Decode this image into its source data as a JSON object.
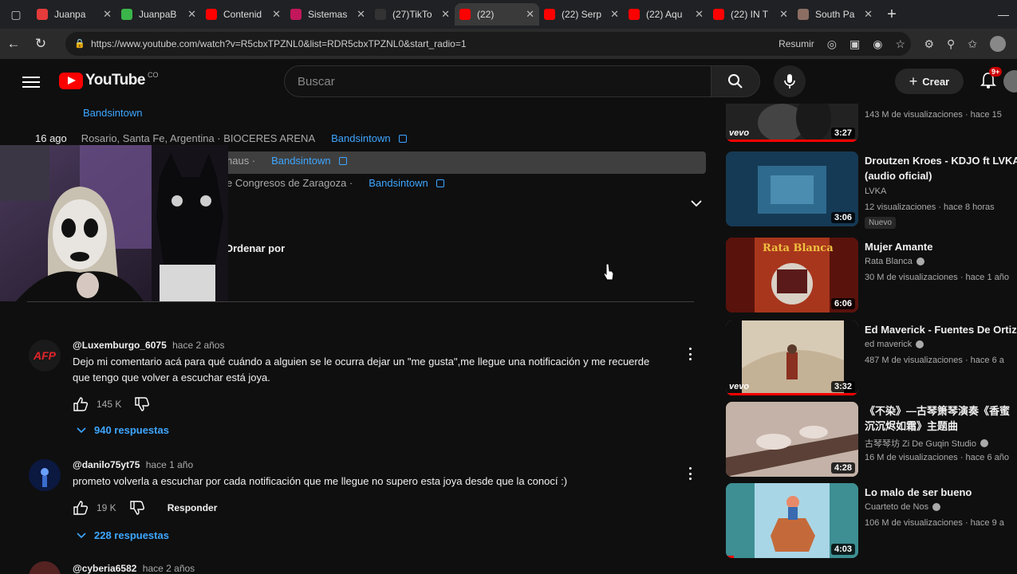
{
  "browser": {
    "tabs": [
      {
        "label": "Juanpa",
        "color": "#e43b3b",
        "icon": "tiktok-icon"
      },
      {
        "label": "JuanpaB",
        "color": "#3bb54a",
        "icon": "kick-icon"
      },
      {
        "label": "Contenid",
        "color": "#ff0000",
        "icon": "youtube-icon"
      },
      {
        "label": "Sistemas",
        "color": "#c2185b",
        "icon": "doc-icon"
      },
      {
        "label": "(27)TikTo",
        "color": "#333333",
        "icon": "tiktok-icon"
      },
      {
        "label": "(22)",
        "color": "#ff0000",
        "icon": "youtube-icon",
        "active": true
      },
      {
        "label": "(22) Serp",
        "color": "#ff0000",
        "icon": "youtube-icon"
      },
      {
        "label": "(22) Aqu",
        "color": "#ff0000",
        "icon": "youtube-icon"
      },
      {
        "label": "(22) IN T",
        "color": "#ff0000",
        "icon": "youtube-icon"
      },
      {
        "label": "South Pa",
        "color": "#8d6e63",
        "icon": "page-icon"
      }
    ],
    "url": "https://www.youtube.com/watch?v=R5cbxTPZNL0&list=RDR5cbxTPZNL0&start_radio=1",
    "summarize_label": "Resumir"
  },
  "yt": {
    "logo_text": "YouTube",
    "logo_region": "CO",
    "search_placeholder": "Buscar",
    "create_label": "Crear",
    "notif_count": "9+"
  },
  "tours": {
    "top_link": "Bandsintown",
    "rows": [
      {
        "date": "16 ago",
        "place": "Rosario, Santa Fe, Argentina · BIOCERES ARENA",
        "link": "Bandsintown"
      },
      {
        "date": "",
        "place": "haus ·",
        "link": "Bandsintown"
      },
      {
        "date": "",
        "place": "e Congresos de Zaragoza ·",
        "link": "Bandsintown"
      }
    ]
  },
  "comments_header": {
    "sort_label": "Ordenar por"
  },
  "comments": [
    {
      "user": "@Luxemburgo_6075",
      "time": "hace 2 años",
      "avatar_text": "AFP",
      "text": "Dejo mi comentario acá para qué cuándo   a alguien se le ocurra dejar un \"me gusta\",me llegue una notificación y me recuerde que tengo que volver a escuchar está joya.",
      "likes": "145 K",
      "replies": "940 respuestas",
      "reply_label": ""
    },
    {
      "user": "@danilo75yt75",
      "time": "hace 1 año",
      "avatar_text": "",
      "text": "prometo volverla a escuchar por cada notificación que me llegue no supero esta joya desde que la conocí :)",
      "likes": "19 K",
      "replies": "228 respuestas",
      "reply_label": "Responder"
    },
    {
      "user": "@cyberia6582",
      "time": "hace 2 años",
      "avatar_text": "",
      "text": "",
      "likes": "",
      "replies": "",
      "reply_label": ""
    }
  ],
  "sidebar": {
    "videos": [
      {
        "title": "",
        "channel": "",
        "meta": "143 M de visualizaciones · hace 15",
        "duration": "3:27",
        "vevo": "vevo",
        "thumb": "#3a3a3a"
      },
      {
        "title": "Droutzen Kroes - KDJO ft LVKA",
        "title2": "(audio oficial)",
        "channel": "LVKA",
        "meta": "12 visualizaciones · hace 8 horas",
        "badge": "Nuevo",
        "duration": "3:06",
        "thumb": "#1f4d6e"
      },
      {
        "title": "Mujer Amante",
        "channel": "Rata Blanca",
        "meta": "30 M de visualizaciones · hace 1 año",
        "duration": "6:06",
        "thumb": "#7a1a12",
        "thumb_text": "Rata Blanca"
      },
      {
        "title": "Ed Maverick - Fuentes De Ortiz",
        "channel": "ed maverick",
        "meta": "487 M de visualizaciones · hace 6 a",
        "duration": "3:32",
        "vevo": "vevo",
        "thumb": "#c9b9a2"
      },
      {
        "title": "《不染》—古琴箫琴演奏《香蜜沉沉烬如霜》主题曲",
        "channel": "古琴琴坊 Zi De Guqin Studio",
        "meta": "16 M de visualizaciones · hace 6 año",
        "duration": "4:28",
        "thumb": "#b9a9a1"
      },
      {
        "title": "Lo malo de ser bueno",
        "channel": "Cuarteto de Nos",
        "meta": "106 M de visualizaciones · hace 9 a",
        "duration": "4:03",
        "thumb": "#4fa7a8"
      }
    ]
  }
}
